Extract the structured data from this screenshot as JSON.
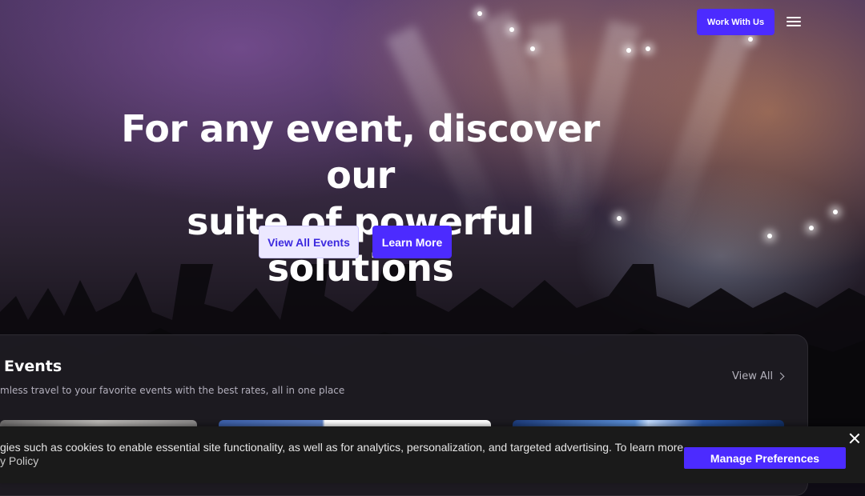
{
  "nav": {
    "work_with_us": "Work With Us",
    "menu_icon": "hamburger-menu-icon"
  },
  "hero": {
    "title_line1": "For any event, discover our",
    "title_line2": "suite of powerful solutions",
    "view_all_events": "View All Events",
    "learn_more": "Learn More"
  },
  "events": {
    "title": "Events",
    "subtitle": "mless travel to your favorite events with the best rates, all in one place",
    "view_all": "View All",
    "chevron_icon": "chevron-right-icon"
  },
  "cookie": {
    "text_line1": "gies such as cookies to enable essential site functionality, as well as for analytics, personalization, and targeted advertising. To learn more,",
    "text_line2": "y Policy",
    "manage_preferences": "Manage Preferences",
    "close_icon": "close-icon"
  },
  "colors": {
    "accent": "#4c2bff",
    "accent_light": "#ece8ff",
    "panel": "#1e1c22",
    "banner": "#1a1a1a"
  }
}
